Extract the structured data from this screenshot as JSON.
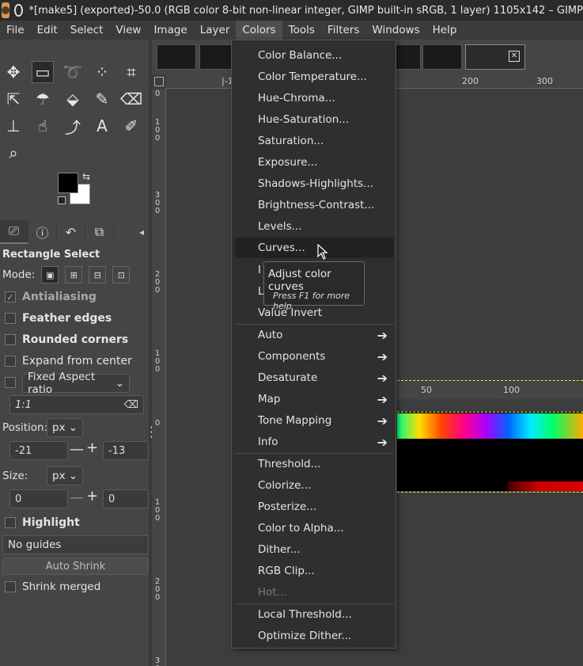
{
  "window": {
    "title": "*[make5] (exported)-50.0 (RGB color 8-bit non-linear integer, GIMP built-in sRGB, 1 layer) 1105x142 – GIMP"
  },
  "menubar": [
    "File",
    "Edit",
    "Select",
    "View",
    "Image",
    "Layer",
    "Colors",
    "Tools",
    "Filters",
    "Windows",
    "Help"
  ],
  "tool_options": {
    "title": "Rectangle Select",
    "mode_label": "Mode:",
    "antialiasing": "Antialiasing",
    "feather_edges": "Feather edges",
    "rounded_corners": "Rounded corners",
    "expand_from_center": "Expand from center",
    "fixed_aspect": "Fixed Aspect ratio",
    "aspect_value": "1:1",
    "position_label": "Position:",
    "position_unit": "px",
    "position_x": "-21",
    "position_y": "-13",
    "size_label": "Size:",
    "size_unit": "px",
    "size_w": "0",
    "size_h": "0",
    "highlight": "Highlight",
    "guides": "No guides",
    "auto_shrink": "Auto Shrink",
    "shrink_merged": "Shrink merged"
  },
  "rulers": {
    "h_labels": [
      "|-1",
      "200",
      "300",
      "50",
      "100"
    ],
    "v_groups": [
      [
        "0"
      ],
      [
        "1",
        "0",
        "0"
      ],
      [
        "3",
        "0",
        "0"
      ],
      [
        "2",
        "0",
        "0"
      ],
      [
        "1",
        "0",
        "0"
      ],
      [
        "0"
      ],
      [
        "1",
        "0",
        "0"
      ],
      [
        "2",
        "0",
        "0"
      ],
      [
        "3",
        "0",
        "0"
      ]
    ]
  },
  "colors_menu": {
    "items": [
      {
        "label": "Color Balance...",
        "submenu": false
      },
      {
        "label": "Color Temperature...",
        "submenu": false
      },
      {
        "label": "Hue-Chroma...",
        "submenu": false
      },
      {
        "label": "Hue-Saturation...",
        "submenu": false
      },
      {
        "label": "Saturation...",
        "submenu": false
      },
      {
        "label": "Exposure...",
        "submenu": false
      },
      {
        "label": "Shadows-Highlights...",
        "submenu": false
      },
      {
        "label": "Brightness-Contrast...",
        "submenu": false
      },
      {
        "label": "Levels...",
        "submenu": false
      },
      {
        "label": "Curves...",
        "submenu": false
      },
      {
        "label": "I",
        "submenu": false
      },
      {
        "label": "L",
        "submenu": false
      },
      {
        "label": "Value Invert",
        "submenu": false
      },
      {
        "label": "Auto",
        "submenu": true
      },
      {
        "label": "Components",
        "submenu": true
      },
      {
        "label": "Desaturate",
        "submenu": true
      },
      {
        "label": "Map",
        "submenu": true
      },
      {
        "label": "Tone Mapping",
        "submenu": true
      },
      {
        "label": "Info",
        "submenu": true
      },
      {
        "label": "Threshold...",
        "submenu": false
      },
      {
        "label": "Colorize...",
        "submenu": false
      },
      {
        "label": "Posterize...",
        "submenu": false
      },
      {
        "label": "Color to Alpha...",
        "submenu": false
      },
      {
        "label": "Dither...",
        "submenu": false
      },
      {
        "label": "RGB Clip...",
        "submenu": false
      },
      {
        "label": "Hot...",
        "submenu": false,
        "disabled": true
      },
      {
        "label": "Local Threshold...",
        "submenu": false
      },
      {
        "label": "Optimize Dither...",
        "submenu": false
      }
    ],
    "highlighted": "Curves..."
  },
  "tooltip": {
    "main": "Adjust color curves",
    "help": "Press F1 for more help"
  },
  "colors": {
    "menu_bg": "#2f2f2f",
    "panel_bg": "#454545",
    "selection": "#eeee33"
  }
}
